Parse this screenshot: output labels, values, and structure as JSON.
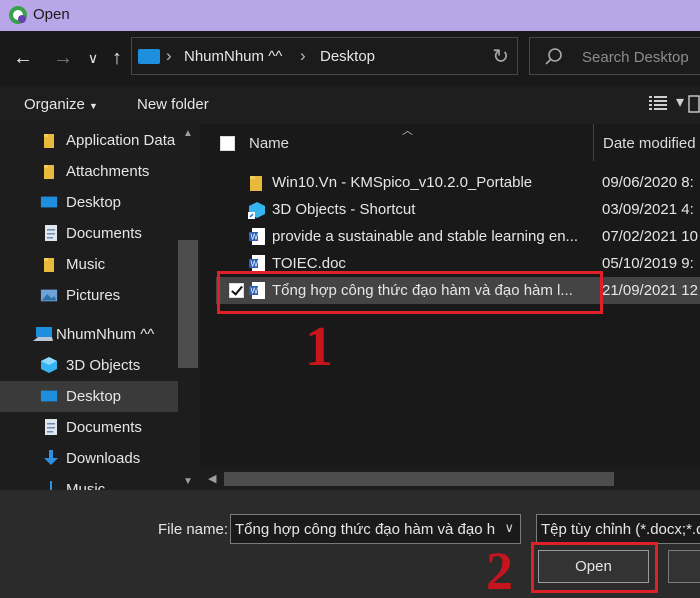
{
  "window": {
    "title": "Open"
  },
  "nav": {
    "back_icon": "arrow-left-icon",
    "forward_icon": "arrow-right-icon",
    "recent_icon": "chevron-down-icon",
    "up_icon": "arrow-up-icon",
    "breadcrumbs": [
      "NhumNhum ^^",
      "Desktop"
    ],
    "search_placeholder": "Search Desktop"
  },
  "toolbar": {
    "organize_label": "Organize",
    "new_folder_label": "New folder"
  },
  "sidebar": {
    "items": [
      {
        "label": "Application Data",
        "icon": "folder-icon"
      },
      {
        "label": "Attachments",
        "icon": "folder-icon"
      },
      {
        "label": "Desktop",
        "icon": "desktop-icon"
      },
      {
        "label": "Documents",
        "icon": "documents-icon"
      },
      {
        "label": "Music",
        "icon": "folder-icon"
      },
      {
        "label": "Pictures",
        "icon": "pictures-icon"
      },
      {
        "label": "NhumNhum ^^",
        "icon": "computer-icon"
      },
      {
        "label": "3D Objects",
        "icon": "3d-objects-icon"
      },
      {
        "label": "Desktop",
        "icon": "desktop-icon",
        "selected": true
      },
      {
        "label": "Documents",
        "icon": "documents-icon"
      },
      {
        "label": "Downloads",
        "icon": "downloads-icon"
      },
      {
        "label": "Music",
        "icon": "music-icon"
      }
    ]
  },
  "filelist": {
    "columns": {
      "name": "Name",
      "date": "Date modified"
    },
    "rows": [
      {
        "name": "Win10.Vn - KMSpico_v10.2.0_Portable",
        "date": "09/06/2020 8:",
        "icon": "folder-icon"
      },
      {
        "name": "3D Objects - Shortcut",
        "date": "03/09/2021 4:",
        "icon": "shortcut-icon"
      },
      {
        "name": "provide a sustainable and stable learning en...",
        "date": "07/02/2021 10",
        "icon": "word-doc-icon"
      },
      {
        "name": "TOIEC.doc",
        "date": "05/10/2019 9:",
        "icon": "word-doc-icon"
      },
      {
        "name": "Tổng hợp công thức đạo hàm và đạo hàm l...",
        "date": "21/09/2021 12",
        "icon": "word-doc-icon",
        "selected": true
      }
    ]
  },
  "annotations": {
    "step1": "1",
    "step2": "2",
    "color": "#e02028"
  },
  "bottom": {
    "file_name_label": "File name:",
    "file_name_value": "Tổng hợp công thức đạo hàm và đạo h",
    "file_type_value": "Tệp tùy chỉnh (*.docx;*.d",
    "open_label": "Open"
  },
  "colors": {
    "titlebar": "#b8a6e8",
    "accent_blue": "#1e8fdd",
    "folder_yellow": "#e8b93c"
  }
}
